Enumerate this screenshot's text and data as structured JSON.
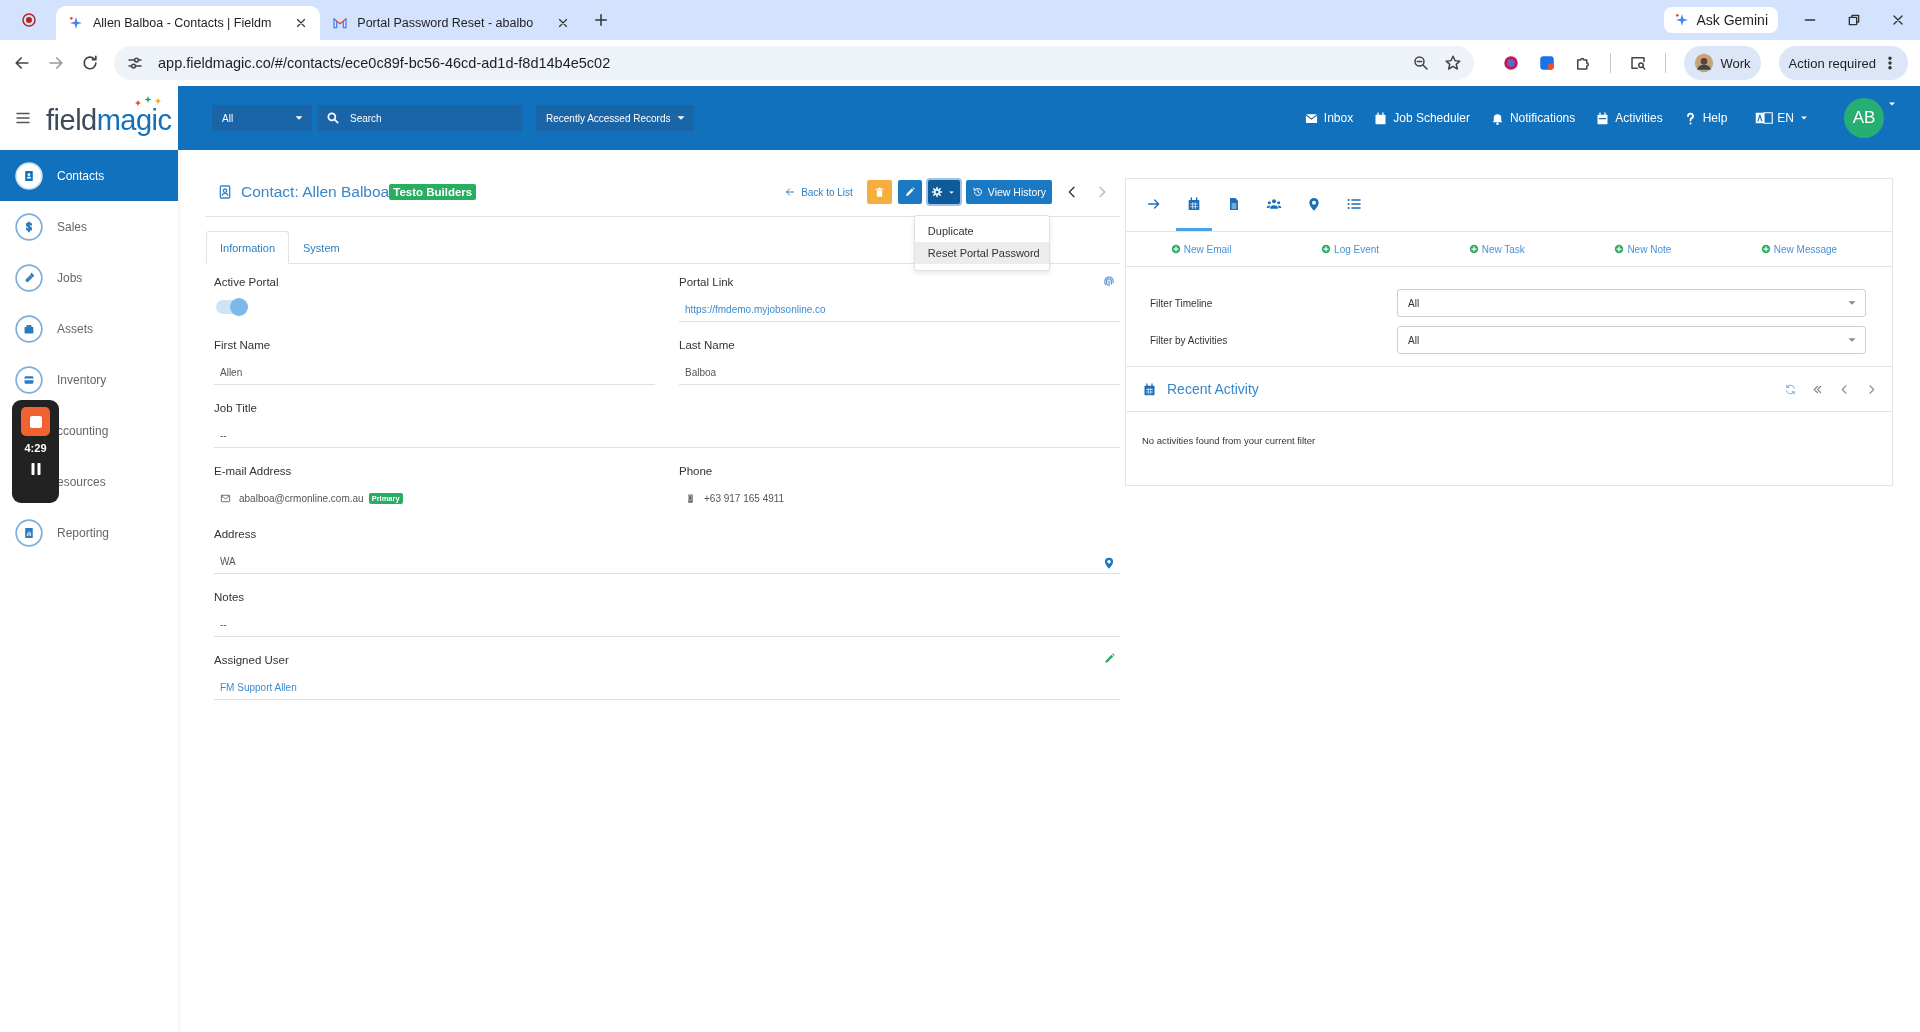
{
  "browser": {
    "tabs": [
      {
        "title": "Allen Balboa - Contacts | Fieldm",
        "selected": true
      },
      {
        "title": "Portal Password Reset - abalbo",
        "selected": false
      }
    ],
    "url": "app.fieldmagic.co/#/contacts/ece0c89f-bc56-46cd-ad1d-f8d14b4e5c02",
    "gemini": "Ask Gemini",
    "profile": "Work",
    "action": "Action required"
  },
  "header": {
    "logo": {
      "part_1": "field",
      "part_2": "magic"
    },
    "scope": "All",
    "search": {
      "placeholder": "Search"
    },
    "recent": "Recently Accessed Records",
    "nav": [
      "Inbox",
      "Job Scheduler",
      "Notifications",
      "Activities",
      "Help"
    ],
    "language": "EN",
    "avatar": "AB"
  },
  "sidebar": {
    "items": [
      {
        "label": "Contacts",
        "selected": true
      },
      {
        "label": "Sales",
        "selected": false
      },
      {
        "label": "Jobs",
        "selected": false
      },
      {
        "label": "Assets",
        "selected": false
      },
      {
        "label": "Inventory",
        "selected": false
      },
      {
        "label": "ccounting",
        "selected": false
      },
      {
        "label": "esources",
        "selected": false
      },
      {
        "label": "Reporting",
        "selected": false
      }
    ]
  },
  "recorder": {
    "time": "4:29"
  },
  "contact": {
    "title": "Contact: Allen Balboa",
    "tag": "Testo Builders",
    "back": "Back to List",
    "history": "View History",
    "menu": [
      {
        "label": "Duplicate",
        "highlighted": false
      },
      {
        "label": "Reset Portal Password",
        "highlighted": true
      }
    ],
    "tabs": [
      {
        "label": "Information",
        "selected": true
      },
      {
        "label": "System",
        "selected": false
      }
    ],
    "rows": [
      [
        {
          "label": "Active Portal",
          "kind": "toggle",
          "on": true
        },
        {
          "label": "Portal Link",
          "kind": "link",
          "value": "https://fmdemo.myjobsonline.co"
        }
      ],
      [
        {
          "label": "First Name",
          "kind": "text",
          "value": "Allen"
        },
        {
          "label": "Last Name",
          "kind": "text",
          "value": "Balboa"
        }
      ],
      [
        {
          "label": "Job Title",
          "kind": "text",
          "value": "--"
        }
      ],
      [
        {
          "label": "E-mail Address",
          "kind": "email",
          "value": "abalboa@crmonline.com.au",
          "badge": "Primary"
        },
        {
          "label": "Phone",
          "kind": "phone",
          "value": "+63 917 165 4911"
        }
      ],
      [
        {
          "label": "Address",
          "kind": "address",
          "value": "WA"
        }
      ],
      [
        {
          "label": "Notes",
          "kind": "text",
          "value": "--"
        }
      ],
      [
        {
          "label": "Assigned User",
          "kind": "user",
          "value": "FM Support Allen"
        }
      ]
    ]
  },
  "panel": {
    "tabs": [
      {
        "selected": false
      },
      {
        "selected": true
      },
      {
        "selected": false
      },
      {
        "selected": false
      },
      {
        "selected": false
      },
      {
        "selected": false
      }
    ],
    "actions": [
      "New Email",
      "Log Event",
      "New Task",
      "New Note",
      "New Message"
    ],
    "filters": [
      {
        "label": "Filter Timeline",
        "value": "All"
      },
      {
        "label": "Filter by Activities",
        "value": "All"
      }
    ],
    "recent": {
      "title": "Recent Activity",
      "empty": "No activities found from your current filter"
    }
  }
}
